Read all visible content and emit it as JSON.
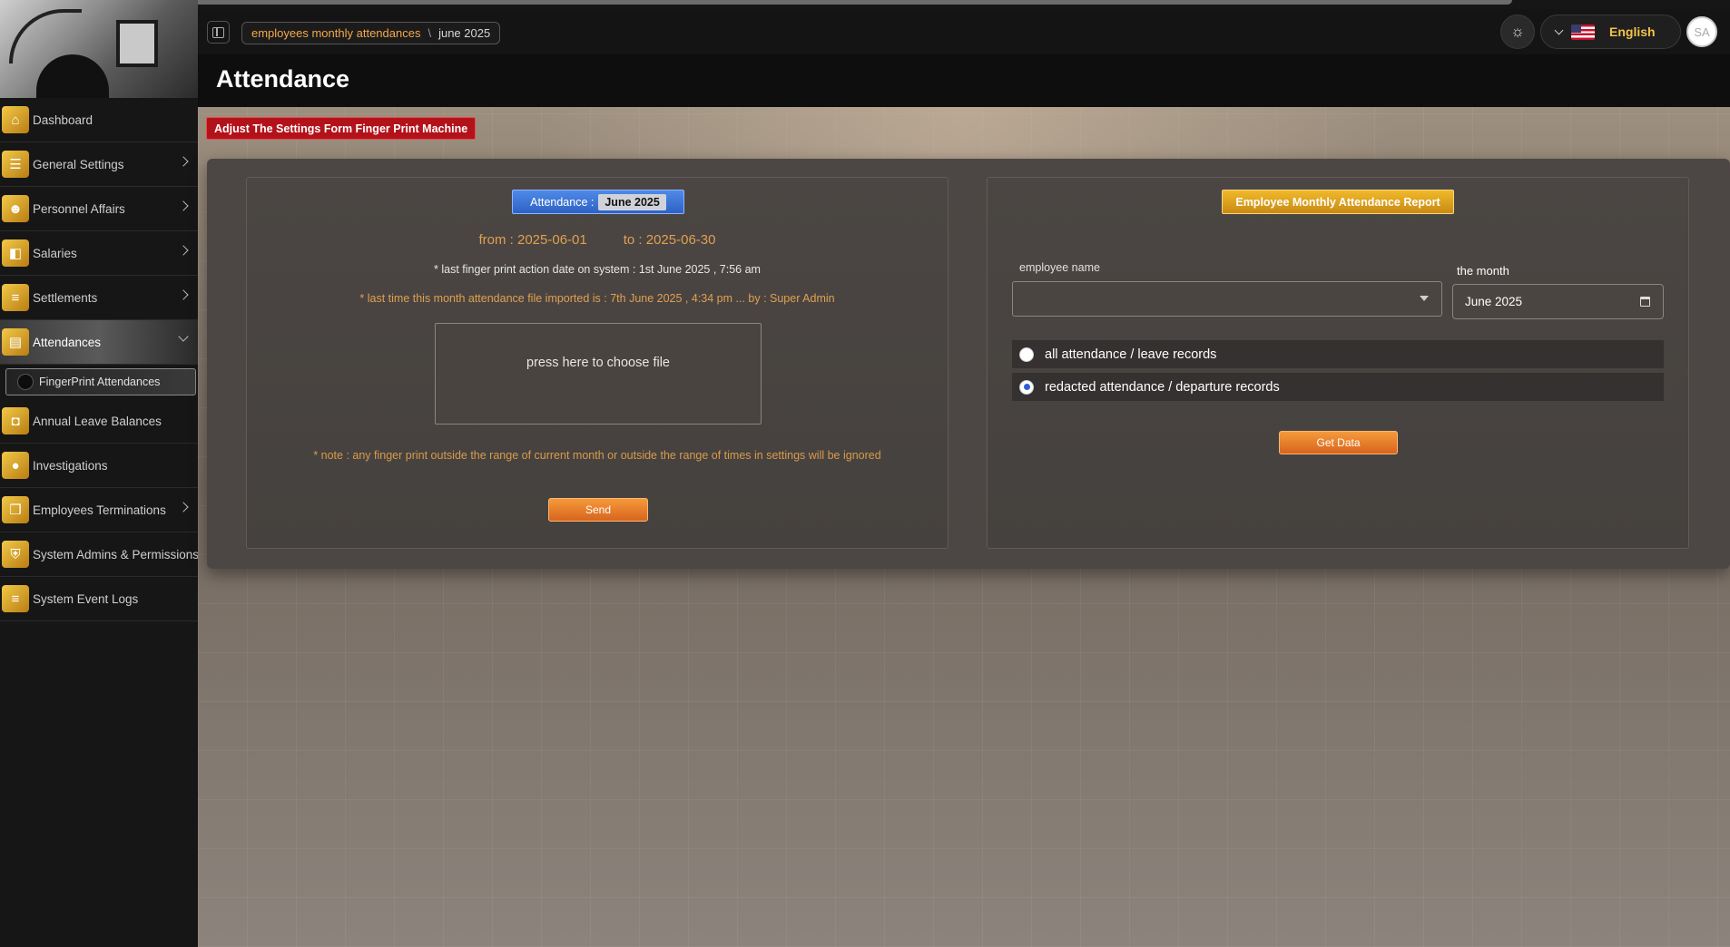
{
  "sidebar": {
    "items": [
      {
        "label": "Dashboard",
        "icon": "home-icon",
        "has_children": false
      },
      {
        "label": "General Settings",
        "icon": "sliders-icon",
        "has_children": true
      },
      {
        "label": "Personnel Affairs",
        "icon": "users-icon",
        "has_children": true
      },
      {
        "label": "Salaries",
        "icon": "money-icon",
        "has_children": true
      },
      {
        "label": "Settlements",
        "icon": "list-icon",
        "has_children": true
      },
      {
        "label": "Attendances",
        "icon": "calendar-icon",
        "has_children": true,
        "expanded": true
      },
      {
        "label": "Annual Leave Balances",
        "icon": "bag-icon",
        "has_children": false
      },
      {
        "label": "Investigations",
        "icon": "circle-icon",
        "has_children": false
      },
      {
        "label": "Employees Terminations",
        "icon": "copy-icon",
        "has_children": true
      },
      {
        "label": "System Admins & Permissions",
        "icon": "shield-icon",
        "has_children": false
      },
      {
        "label": "System Event Logs",
        "icon": "list-icon",
        "has_children": false
      }
    ],
    "sub_item": "FingerPrint Attendances"
  },
  "topbar": {
    "breadcrumb": [
      "employees monthly attendances",
      "june 2025"
    ],
    "breadcrumb_separator": "\\",
    "language": "English",
    "avatar_initials": "SA"
  },
  "page": {
    "title": "Attendance",
    "warning": "Adjust The Settings Form Finger Print Machine"
  },
  "left_card": {
    "badge_label": "Attendance :",
    "badge_month": "June 2025",
    "from": "from : 2025-06-01",
    "to": "to : 2025-06-30",
    "last_action": "* last finger print action date on system : 1st June 2025 , 7:56 am",
    "last_import": "* last time this month attendance file imported is : 7th June 2025 , 4:34 pm ... by : Super Admin",
    "file_prompt": "press here to choose file",
    "note": "* note : any finger print outside the range of current month or outside the range of times in settings will be ignored",
    "send_label": "Send"
  },
  "right_card": {
    "badge_label": "Employee Monthly Attendance Report",
    "employee_label": "employee name",
    "employee_value": "",
    "month_label": "the month",
    "month_value": "June 2025",
    "radio_options": [
      {
        "label": "all attendance / leave records",
        "checked": false
      },
      {
        "label": "redacted attendance / departure records",
        "checked": true
      }
    ],
    "get_data_label": "Get Data"
  },
  "colors": {
    "accent_orange": "#e27a2a",
    "accent_gold": "#e0aa2a",
    "accent_blue": "#3a72d8",
    "warning_red": "#b4121a"
  }
}
